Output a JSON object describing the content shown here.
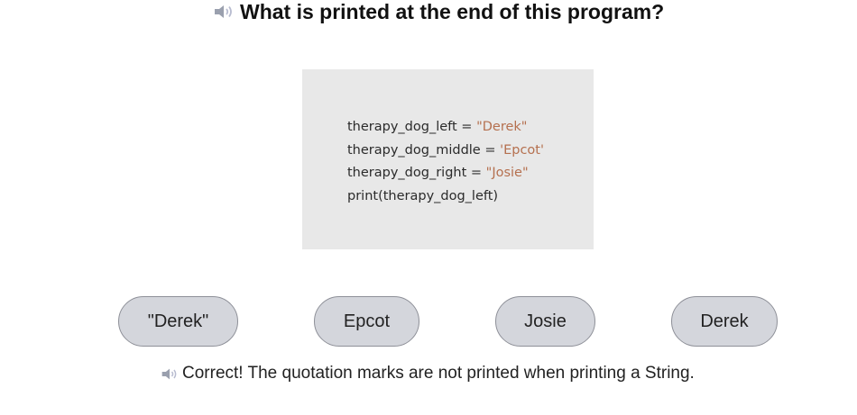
{
  "question": {
    "icon": "speaker-icon",
    "text": "What is printed at the end of this program?"
  },
  "code": {
    "lines": [
      {
        "prefix": "therapy_dog_left = ",
        "string": "\"Derek\""
      },
      {
        "prefix": "therapy_dog_middle = ",
        "string": "'Epcot'"
      },
      {
        "prefix": "therapy_dog_right = ",
        "string": "\"Josie\""
      },
      {
        "prefix": "print(therapy_dog_left)",
        "string": ""
      }
    ],
    "string_color": "#b5704f"
  },
  "answers": [
    {
      "label": "\"Derek\""
    },
    {
      "label": "Epcot"
    },
    {
      "label": "Josie"
    },
    {
      "label": "Derek"
    }
  ],
  "feedback": {
    "icon": "speaker-icon",
    "text": "Correct! The quotation marks are not printed when printing a String."
  },
  "colors": {
    "answer_background": "#d4d6dc",
    "code_background": "#e8e8e8"
  }
}
